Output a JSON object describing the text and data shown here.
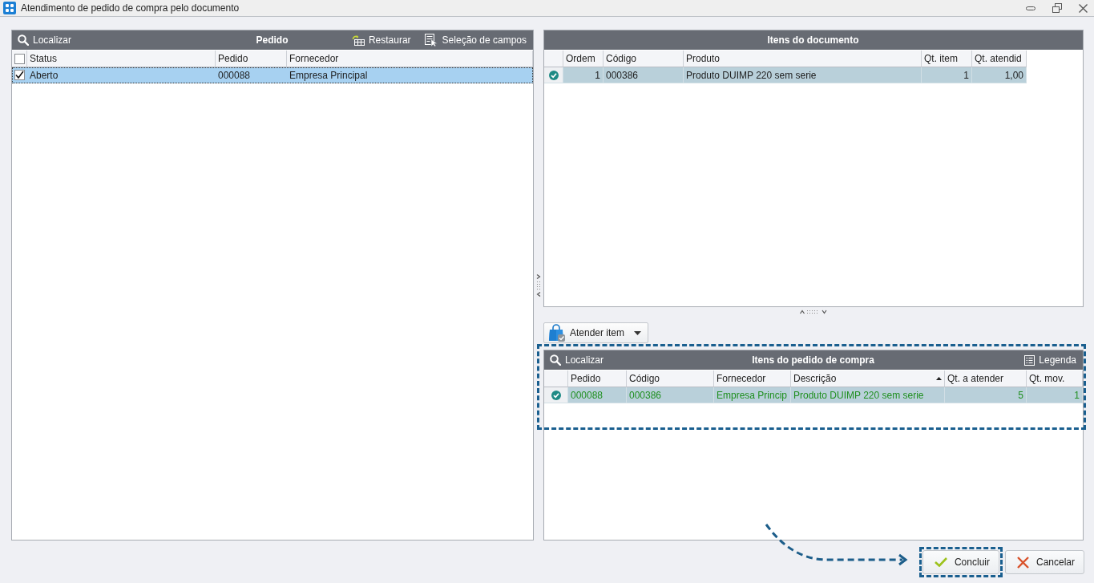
{
  "window": {
    "title": "Atendimento de pedido de compra pelo documento"
  },
  "orders": {
    "search": "Localizar",
    "title": "Pedido",
    "actions": [
      {
        "kind": "restore",
        "label": "Restaurar"
      },
      {
        "kind": "fields",
        "label": "Seleção de campos"
      }
    ],
    "select_all": {
      "checked": false
    },
    "columns": [
      {
        "label": "Status",
        "numeric": false
      },
      {
        "label": "Pedido",
        "numeric": false
      },
      {
        "label": "Fornecedor",
        "numeric": false
      }
    ],
    "rows": [
      {
        "checked": true,
        "selected": true,
        "cells": [
          "Aberto",
          "000088",
          "Empresa Principal"
        ]
      }
    ]
  },
  "document_items": {
    "title": "Itens do documento",
    "columns": [
      {
        "label": "Ordem",
        "numeric": true
      },
      {
        "label": "Código",
        "numeric": false
      },
      {
        "label": "Produto",
        "numeric": false
      },
      {
        "label": "Qt. item",
        "numeric": true
      },
      {
        "label": "Qt. atendid",
        "numeric": true
      }
    ],
    "rows": [
      {
        "attended": true,
        "selected": true,
        "cells": [
          "1",
          "000386",
          "Produto DUIMP 220 sem serie",
          "1",
          "1,00"
        ]
      }
    ]
  },
  "attend_button": {
    "label": "Atender item",
    "menu": true
  },
  "order_items": {
    "search": "Localizar",
    "title": "Itens do pedido de compra",
    "legend": "Legenda",
    "highlighted": true,
    "columns": [
      {
        "label": "Pedido",
        "numeric": false,
        "sorted": false
      },
      {
        "label": "Código",
        "numeric": false,
        "sorted": false
      },
      {
        "label": "Fornecedor",
        "numeric": false,
        "sorted": false
      },
      {
        "label": "Descrição",
        "numeric": false,
        "sorted": true
      },
      {
        "label": "Qt. a atender",
        "numeric": true,
        "sorted": false
      },
      {
        "label": "Qt. mov.",
        "numeric": true,
        "sorted": false
      }
    ],
    "rows": [
      {
        "attended": true,
        "selected": true,
        "color": "#1f8f1f",
        "cells": [
          "000088",
          "000386",
          "Empresa Princip",
          "Produto DUIMP 220 sem serie",
          "5",
          "1"
        ]
      }
    ]
  },
  "footer": {
    "pointer_arrow": true,
    "buttons": [
      {
        "kind": "confirm",
        "label": "Concluir",
        "highlighted": true
      },
      {
        "kind": "cancel",
        "label": "Cancelar",
        "highlighted": false
      }
    ]
  }
}
